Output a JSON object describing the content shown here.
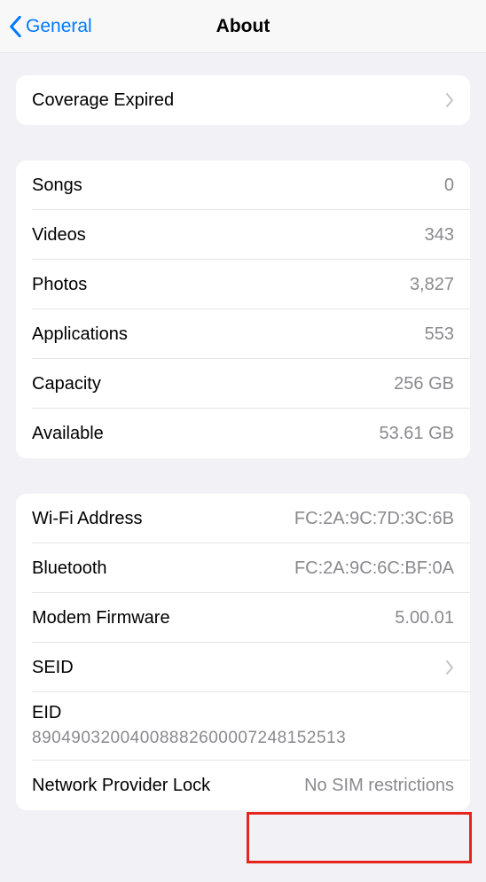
{
  "nav": {
    "back_label": "General",
    "title": "About"
  },
  "section_coverage": {
    "label": "Coverage Expired"
  },
  "section_storage": {
    "songs": {
      "label": "Songs",
      "value": "0"
    },
    "videos": {
      "label": "Videos",
      "value": "343"
    },
    "photos": {
      "label": "Photos",
      "value": "3,827"
    },
    "applications": {
      "label": "Applications",
      "value": "553"
    },
    "capacity": {
      "label": "Capacity",
      "value": "256 GB"
    },
    "available": {
      "label": "Available",
      "value": "53.61 GB"
    }
  },
  "section_identifiers": {
    "wifi": {
      "label": "Wi-Fi Address",
      "value": "FC:2A:9C:7D:3C:6B"
    },
    "bluetooth": {
      "label": "Bluetooth",
      "value": "FC:2A:9C:6C:BF:0A"
    },
    "modem": {
      "label": "Modem Firmware",
      "value": "5.00.01"
    },
    "seid": {
      "label": "SEID"
    },
    "eid": {
      "label": "EID",
      "value": "89049032004008882600007248152513"
    },
    "network_lock": {
      "label": "Network Provider Lock",
      "value": "No SIM restrictions"
    }
  }
}
